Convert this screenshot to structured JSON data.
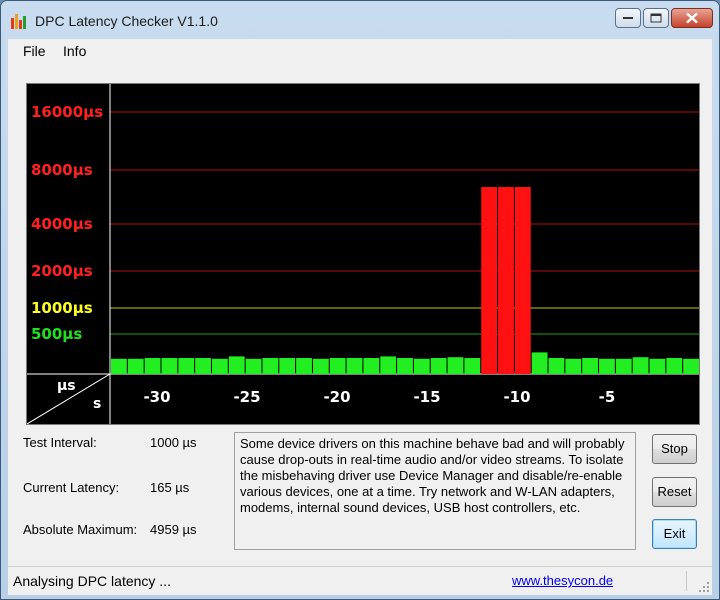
{
  "window": {
    "title": "DPC Latency Checker V1.1.0"
  },
  "menu": {
    "items": [
      "File",
      "Info"
    ]
  },
  "graph": {
    "y_axis_unit": "µs",
    "x_axis_unit": "s",
    "y_ticks": [
      {
        "label": "16000µs",
        "color": "#ff2020"
      },
      {
        "label": "8000µs",
        "color": "#ff2020"
      },
      {
        "label": "4000µs",
        "color": "#ff2020"
      },
      {
        "label": "2000µs",
        "color": "#ff2020"
      },
      {
        "label": "1000µs",
        "color": "#ffff20"
      },
      {
        "label": "500µs",
        "color": "#20e020"
      }
    ],
    "x_ticks": [
      "-30",
      "-25",
      "-20",
      "-15",
      "-10",
      "-5"
    ],
    "colors": {
      "ok": "#22ee22",
      "alert": "#ff1111"
    }
  },
  "chart_data": {
    "type": "bar",
    "xlabel": "s",
    "ylabel": "µs",
    "y_scale": "log2",
    "x": [
      -33,
      -32,
      -31,
      -30,
      -29,
      -28,
      -27,
      -26,
      -25,
      -24,
      -23,
      -22,
      -21,
      -20,
      -19,
      -18,
      -17,
      -16,
      -15,
      -14,
      -13,
      -12,
      -11,
      -10,
      -9,
      -8,
      -7,
      -6,
      -5,
      -4,
      -3,
      -2,
      -1
    ],
    "values": [
      190,
      190,
      200,
      200,
      200,
      200,
      190,
      220,
      190,
      200,
      200,
      200,
      190,
      200,
      200,
      200,
      220,
      200,
      190,
      200,
      210,
      200,
      4959,
      4959,
      4959,
      270,
      200,
      190,
      200,
      190,
      190,
      210,
      190,
      200,
      190
    ],
    "colors": [
      "ok",
      "ok",
      "ok",
      "ok",
      "ok",
      "ok",
      "ok",
      "ok",
      "ok",
      "ok",
      "ok",
      "ok",
      "ok",
      "ok",
      "ok",
      "ok",
      "ok",
      "ok",
      "ok",
      "ok",
      "ok",
      "ok",
      "alert",
      "alert",
      "alert",
      "ok",
      "ok",
      "ok",
      "ok",
      "ok",
      "ok",
      "ok",
      "ok",
      "ok",
      "ok"
    ]
  },
  "stats": {
    "test_interval": {
      "label": "Test Interval:",
      "value": "1000 µs"
    },
    "current_latency": {
      "label": "Current Latency:",
      "value": "165 µs"
    },
    "absolute_maximum": {
      "label": "Absolute Maximum:",
      "value": "4959 µs"
    }
  },
  "message": "Some device drivers on this machine behave bad and will probably cause drop-outs in real-time audio and/or video streams. To isolate the misbehaving driver use Device Manager and disable/re-enable various devices, one at a time. Try network and W-LAN adapters, modems, internal sound devices, USB host controllers, etc.",
  "buttons": {
    "stop": "Stop",
    "reset": "Reset",
    "exit": "Exit"
  },
  "status": {
    "text": "Analysing DPC latency ...",
    "link": "www.thesycon.de"
  }
}
